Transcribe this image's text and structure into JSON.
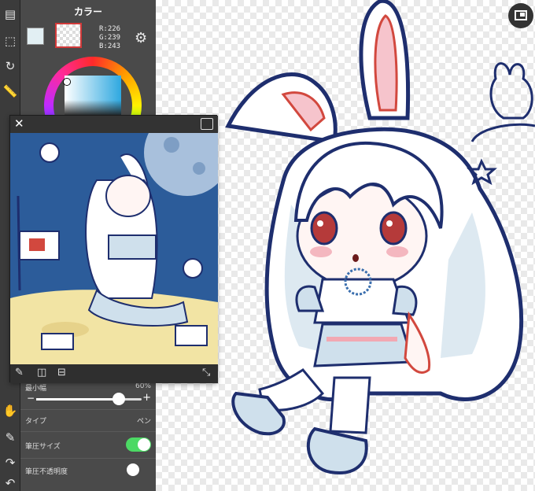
{
  "color_panel": {
    "title": "カラー",
    "rgb": {
      "r": "R:226",
      "g": "G:239",
      "b": "B:243"
    },
    "main_color": "#e2eff3",
    "hue": "#2ea8e0"
  },
  "brush_panel": {
    "size_label": "最小幅",
    "size_value": "60%",
    "size_fraction": 0.78,
    "type_label": "タイプ",
    "type_value": "ペン",
    "pressure_size_label": "筆圧サイズ",
    "pressure_size_on": true,
    "pressure_opacity_label": "筆圧不透明度",
    "pressure_opacity_on": false
  },
  "colors": {
    "accent_green": "#4cd964",
    "line_navy": "#1e2e6e",
    "line_red": "#d2483e"
  }
}
